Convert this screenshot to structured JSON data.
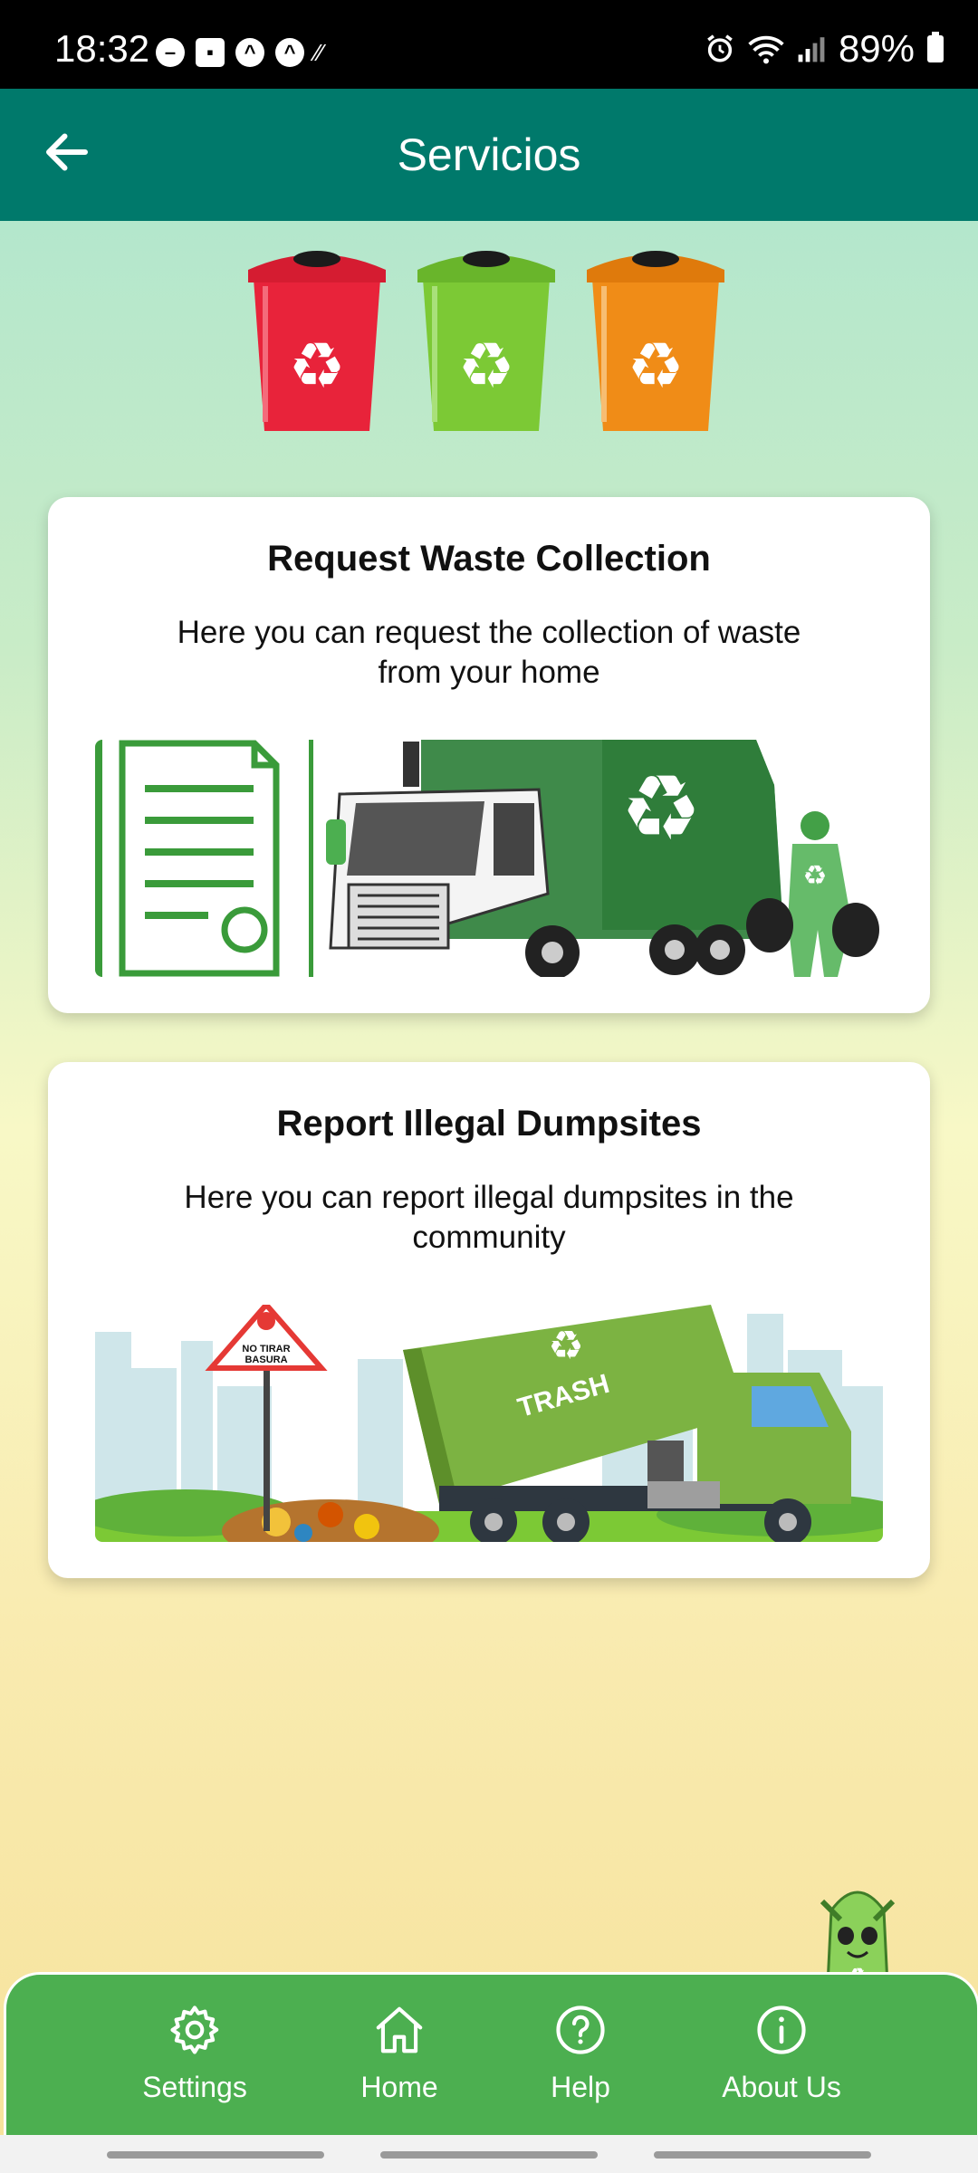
{
  "status_bar": {
    "time": "18:32",
    "battery": "89%",
    "icons": [
      "dnd-icon",
      "gallery-icon",
      "app-icon",
      "app-icon",
      "signal-dots-icon",
      "alarm-icon",
      "wifi-icon",
      "cell-signal-icon",
      "battery-icon"
    ]
  },
  "app_bar": {
    "title": "Servicios",
    "back_icon": "arrow-left-icon"
  },
  "header_image": {
    "icons": [
      "red-recycle-bin",
      "green-recycle-bin",
      "orange-recycle-bin"
    ]
  },
  "cards": [
    {
      "title": "Request Waste Collection",
      "description": "Here you can request the collection of waste from your home",
      "image": "garbage-truck-illustration"
    },
    {
      "title": "Report Illegal Dumpsites",
      "description": "Here you can report illegal dumpsites in the community",
      "image": "dump-truck-illustration",
      "sign_line1": "NO TIRAR",
      "sign_line2": "BASURA",
      "truck_label": "TRASH"
    }
  ],
  "bottom_nav": [
    {
      "label": "Settings",
      "icon": "gear-icon"
    },
    {
      "label": "Home",
      "icon": "home-icon"
    },
    {
      "label": "Help",
      "icon": "help-icon"
    },
    {
      "label": "About Us",
      "icon": "info-icon"
    }
  ],
  "colors": {
    "app_bar": "#00796b",
    "nav_bar": "#4caf50",
    "bin_red": "#e8233a",
    "bin_green": "#7cc935",
    "bin_orange": "#f08c17"
  }
}
